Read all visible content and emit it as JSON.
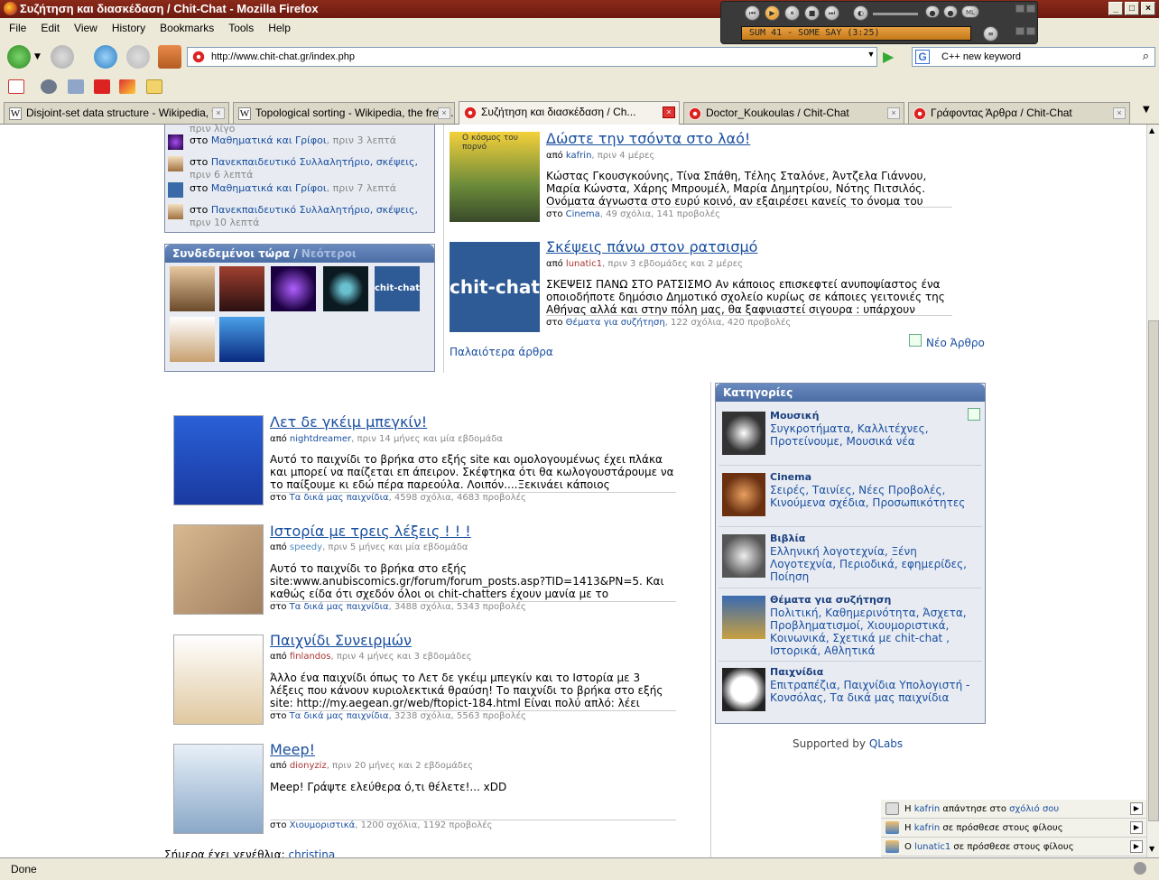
{
  "window": {
    "title": "Συζήτηση και διασκέδαση / Chit-Chat - Mozilla Firefox"
  },
  "player": {
    "song": "SUM 41 - SOME SAY (3:25)"
  },
  "menu": [
    "File",
    "Edit",
    "View",
    "History",
    "Bookmarks",
    "Tools",
    "Help"
  ],
  "nav": {
    "url": "http://www.chit-chat.gr/index.php",
    "search": "C++ new keyword"
  },
  "tabs": [
    {
      "label": "Disjoint-set data structure - Wikipedia, t..."
    },
    {
      "label": "Topological sorting - Wikipedia, the free..."
    },
    {
      "label": "Συζήτηση και διασκέδαση / Ch..."
    },
    {
      "label": "Doctor_Koukoulas / Chit-Chat"
    },
    {
      "label": "Γράφοντας Άρθρα / Chit-Chat"
    }
  ],
  "activity": [
    {
      "pre": "στο",
      "link": "Μαθηματικά και Γρίφοι",
      "when": ", πριν 3 λεπτά"
    },
    {
      "pre": "στο",
      "link": "Πανεκπαιδευτικό Συλλαλητήριο, σκέψεις,",
      "when": "πριν 6 λεπτά"
    },
    {
      "pre": "στο",
      "link": "Μαθηματικά και Γρίφοι",
      "when": ", πριν 7 λεπτά"
    },
    {
      "pre": "στο",
      "link": "Πανεκπαιδευτικό Συλλαλητήριο, σκέψεις,",
      "when": "πριν 10 λεπτά"
    }
  ],
  "activity_top": "πριν λίγο",
  "online": {
    "title": "Συνδεδεμένοι τώρα",
    "sep": "/",
    "newest": "Νεότεροι",
    "chit_label": "chit-chat"
  },
  "top_articles": [
    {
      "title": "Δώστε την τσόντα στο λαό!",
      "by": "από",
      "author": "kafrin",
      "when": ", πριν 4 μέρες",
      "body": "Κώστας Γκουσγκούνης, Τίνα Σπάθη, Τέλης Σταλόνε, Άντζελα Γιάννου, Μαρία Κώνστα, Χάρης Μπρουμέλ, Μαρία Δημητρίου, Νότης Πιτσιλός. Ονόματα άγνωστα στο ευρύ κοινό, αν εξαιρέσει κανείς το όνομα του",
      "in": "στο",
      "cat": "Cinema",
      "stats": ", 49 σχόλια, 141 προβολές",
      "thumb_text": "Ο κόσμος του πορνό"
    },
    {
      "title": "Σκέψεις πάνω στον ρατσισμό",
      "by": "από",
      "author": "lunatic1",
      "when": ", πριν 3 εβδομάδες και 2 μέρες",
      "body": "ΣΚΕΨΕΙΣ ΠΑΝΩ ΣΤΟ ΡΑΤΣΙΣΜΟ Αν κάποιος επισκεφτεί ανυποψίαστος ένα οποιοδήποτε δημόσιο Δημοτικό σχολείο κυρίως σε κάποιες γειτονιές της Αθήνας αλλά και στην πόλη μας, θα ξαφνιαστεί σιγουρα : υπάρχουν",
      "in": "στο",
      "cat": "Θέματα για συζήτηση",
      "stats": ", 122 σχόλια, 420 προβολές",
      "thumb_text": "chit-chat"
    }
  ],
  "new_article": "Νέο Άρθρο",
  "older": "Παλαιότερα άρθρα",
  "games": [
    {
      "title": "Λετ δε γκέιμ μπεγκίν!",
      "by": "από",
      "author": "nightdreamer",
      "when": ", πριν 14 μήνες και μία εβδομάδα",
      "body": "Αυτό το παιχνίδι το βρήκα στο εξής site και ομολογουμένως έχει πλάκα και μπορεί να παίζεται επ άπειρον. Σκέφτηκα ότι θα κωλογουστάρουμε να το παίξουμε κι εδώ πέρα παρεούλα. Λοιπόν....Ξεκινάει κάποιος",
      "in": "στο",
      "cat": "Τα δικά μας παιχνίδια",
      "stats": ", 4598 σχόλια, 4683 προβολές"
    },
    {
      "title": "Ιστορία με τρεις λέξεις ! ! !",
      "by": "από",
      "author": "speedy",
      "when": ", πριν 5 μήνες και μία εβδομάδα",
      "body": "Αυτό το παιχνίδι το βρήκα στο εξής site:www.anubiscomics.gr/forum/forum_posts.asp?TID=1413&PN=5. Και καθώς είδα ότι σχεδόν όλοι οι chit-chatters έχουν μανία με το",
      "in": "στο",
      "cat": "Τα δικά μας παιχνίδια",
      "stats": ", 3488 σχόλια, 5343 προβολές"
    },
    {
      "title": "Παιχνίδι Συνειρμών",
      "by": "από",
      "author": "finlandos",
      "when": ", πριν 4 μήνες και 3 εβδομάδες",
      "body": "Άλλο ένα παιχνίδι όπως το Λετ δε γκέιμ μπεγκίν και το Ιστορία με 3 λέξεις που κάνουν κυριολεκτικά θραύση! Το παιχνίδι το βρήκα στο εξής site: http://my.aegean.gr/web/ftopict-184.html Είναι πολύ απλό: λέει",
      "in": "στο",
      "cat": "Τα δικά μας παιχνίδια",
      "stats": ", 3238 σχόλια, 5563 προβολές"
    },
    {
      "title": "Meep!",
      "by": "από",
      "author": "dionyziz",
      "when": ", πριν 20 μήνες και 2 εβδομάδες",
      "body": "Meep! Γράψτε ελεύθερα ό,τι θέλετε!... xDD",
      "in": "στο",
      "cat": "Χιουμοριστικά",
      "stats": ", 1200 σχόλια, 1192 προβολές"
    }
  ],
  "birthday": {
    "text": "Σήμερα έχει γενέθλια:",
    "name": "christina"
  },
  "categories": {
    "title": "Κατηγορίες",
    "items": [
      {
        "name": "Μουσική",
        "links": "Συγκροτήματα, Καλλιτέχνες, Προτείνουμε, Μουσικά νέα"
      },
      {
        "name": "Cinema",
        "links": "Σειρές, Ταινίες, Νέες Προβολές, Κινούμενα σχέδια, Προσωπικότητες"
      },
      {
        "name": "Βιβλία",
        "links": "Ελληνική λογοτεχνία, Ξένη Λογοτεχνία, Περιοδικά, εφημερίδες, Ποίηση"
      },
      {
        "name": "Θέματα για συζήτηση",
        "links": "Πολιτική, Καθημερινότητα, Άσχετα, Προβληματισμοί, Χιουμοριστικά, Κοινωνικά, Σχετικά με chit-chat , Ιστορικά, Αθλητικά"
      },
      {
        "name": "Παιχνίδια",
        "links": "Επιτραπέζια, Παιχνίδια Υπολογιστή - Κονσόλας, Τα δικά μας παιχνίδια"
      }
    ]
  },
  "supported": {
    "text": "Supported by",
    "link": "QLabs"
  },
  "notifications": [
    {
      "pre": "Η",
      "user": "kafrin",
      "mid": "απάντησε στο",
      "link": "σχόλιό σου"
    },
    {
      "pre": "Η",
      "user": "kafrin",
      "mid": "σε πρόσθεσε στους φίλους",
      "link": ""
    },
    {
      "pre": "Ο",
      "user": "lunatic1",
      "mid": "σε πρόσθεσε στους φίλους",
      "link": ""
    }
  ],
  "status": "Done"
}
